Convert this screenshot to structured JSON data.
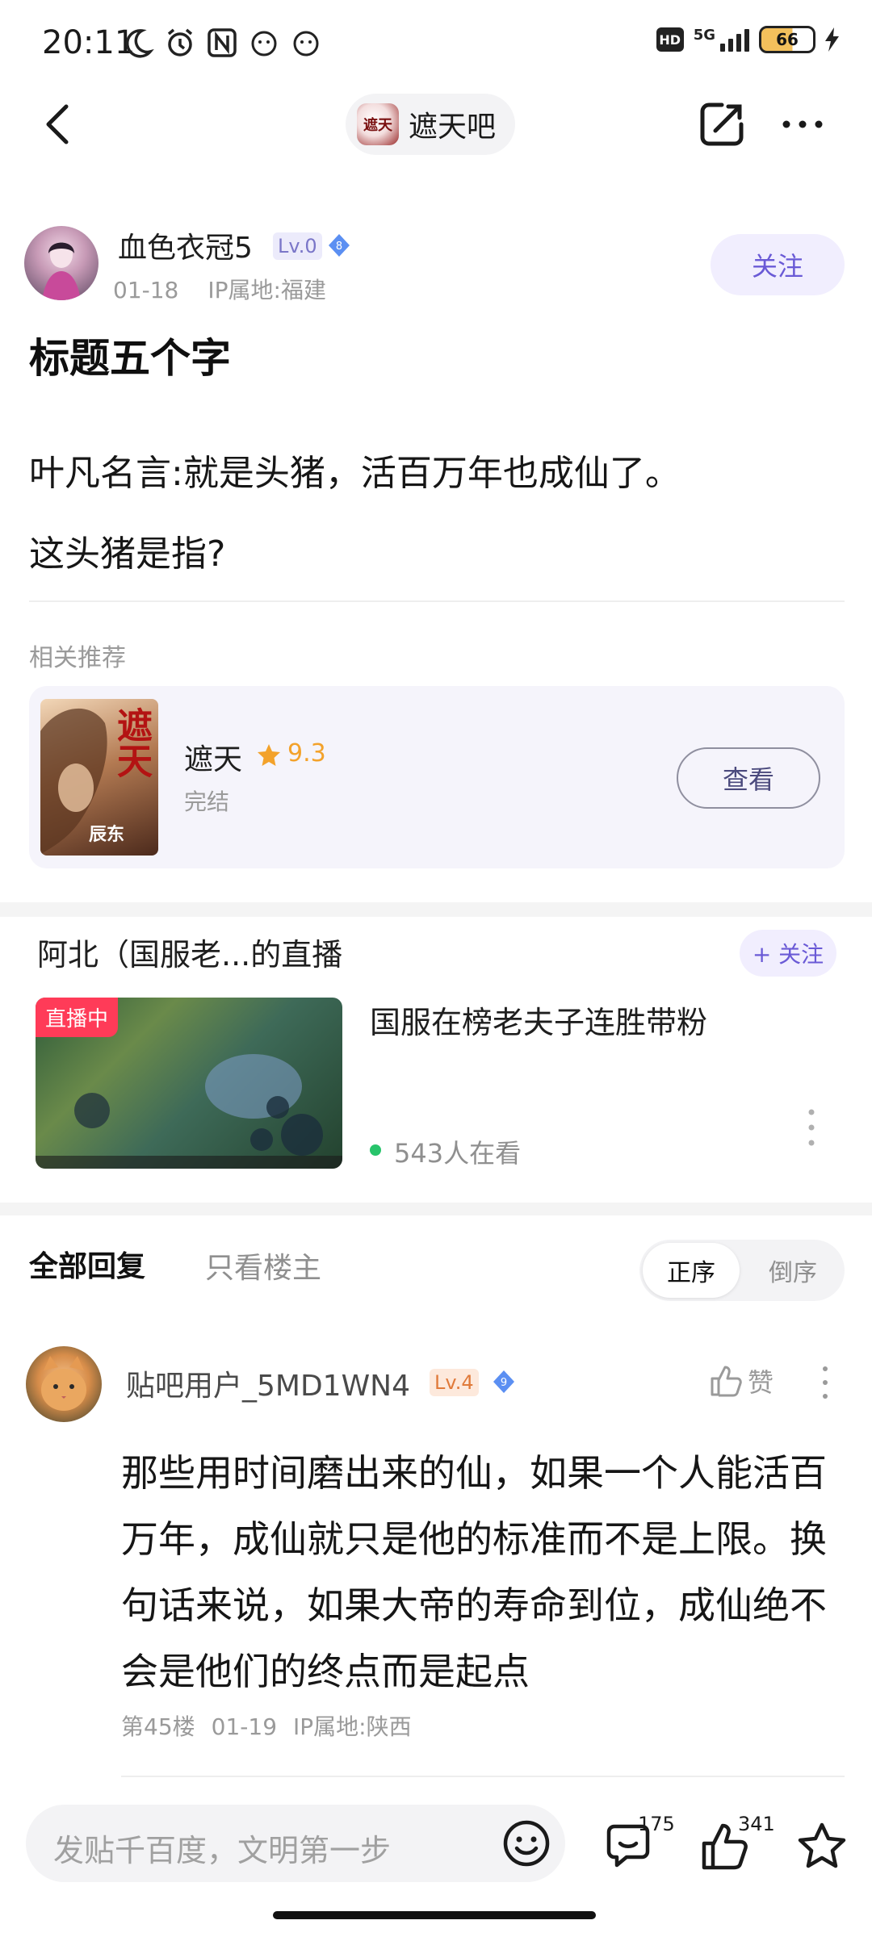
{
  "status_bar": {
    "time": "20:11",
    "network": "5G",
    "hd": "HD",
    "battery": "66"
  },
  "nav": {
    "forum_logo_text": "遮天",
    "forum_name": "遮天吧"
  },
  "post": {
    "author": "血色衣冠5",
    "level": "Lv.0",
    "diamond_level": "8",
    "date": "01-18",
    "ip": "IP属地:福建",
    "follow_label": "关注",
    "title": "标题五个字",
    "body_line1": "叶凡名言:就是头猪，活百万年也成仙了。",
    "body_line2": "这头猪是指?"
  },
  "related": {
    "label": "相关推荐",
    "book": {
      "cover_title": "遮天",
      "cover_author": "辰东",
      "name": "遮天",
      "score": "9.3",
      "status": "完结",
      "view_label": "查看"
    }
  },
  "live": {
    "title": "阿北（国服老...的直播",
    "follow_label": "+ 关注",
    "badge": "直播中",
    "stream_title": "国服在榜老夫子连胜带粉",
    "viewers": "543人在看"
  },
  "replies": {
    "tab_all": "全部回复",
    "tab_op": "只看楼主",
    "sort_asc": "正序",
    "sort_desc": "倒序",
    "items": [
      {
        "user": "贴吧用户_5MD1WN4",
        "level": "Lv.4",
        "diamond_level": "9",
        "like_label": "赞",
        "text": "那些用时间磨出来的仙，如果一个人能活百万年，成仙就只是他的标准而不是上限。换句话来说，如果大帝的寿命到位，成仙绝不会是他们的终点而是起点",
        "floor": "第45楼",
        "date": "01-19",
        "ip": "IP属地:陕西"
      }
    ]
  },
  "bottom_bar": {
    "input_placeholder": "发贴千百度，文明第一步",
    "comment_count": "175",
    "like_count": "341"
  },
  "colors": {
    "accent": "#6a5ad6",
    "accent_bg": "#f1eefe",
    "live_red": "#ff3b58",
    "live_green": "#27c46b",
    "star": "#f3a22b"
  }
}
